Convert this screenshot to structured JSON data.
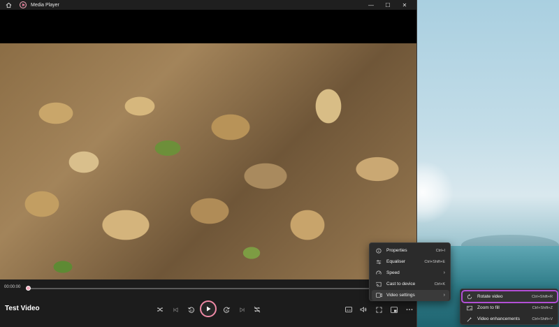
{
  "window": {
    "title": "Media Player",
    "controls": {
      "minimize": "—",
      "maximize": "☐",
      "close": "✕"
    }
  },
  "player": {
    "current_time": "00:00:00",
    "video_title": "Test Video",
    "progress_fraction": 0.0
  },
  "menu": {
    "items": [
      {
        "label": "Properties",
        "shortcut": "Ctrl+I",
        "icon": "info-icon"
      },
      {
        "label": "Equaliser",
        "shortcut": "Ctrl+Shift+E",
        "icon": "equaliser-icon"
      },
      {
        "label": "Speed",
        "shortcut": "",
        "icon": "speed-icon",
        "has_submenu": true
      },
      {
        "label": "Cast to device",
        "shortcut": "Ctrl+K",
        "icon": "cast-icon"
      },
      {
        "label": "Video settings",
        "shortcut": "",
        "icon": "video-settings-icon",
        "has_submenu": true
      }
    ]
  },
  "submenu": {
    "items": [
      {
        "label": "Rotate video",
        "shortcut": "Ctrl+Shift+R",
        "icon": "rotate-icon"
      },
      {
        "label": "Zoom to fill",
        "shortcut": "Ctrl+Shift+Z",
        "icon": "zoom-fill-icon"
      },
      {
        "label": "Video enhancements",
        "shortcut": "Ctrl+Shift+V",
        "icon": "enhance-icon"
      }
    ]
  },
  "colors": {
    "accent": "#f08aa6",
    "highlight_outline": "#b34fd6",
    "menu_bg": "#2b2b2b"
  }
}
